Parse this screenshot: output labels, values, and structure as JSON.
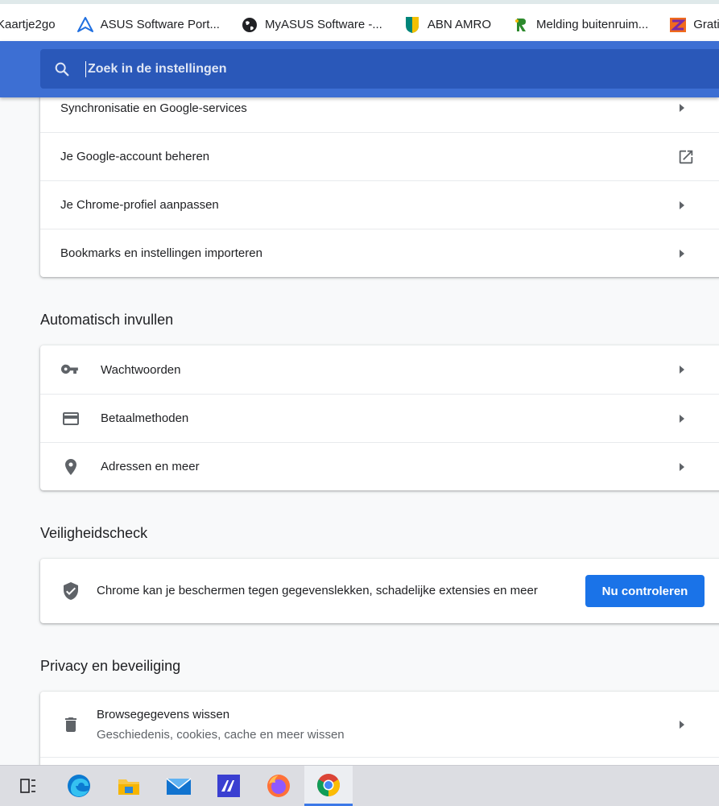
{
  "bookmarks": [
    {
      "label": "Kaartje2go",
      "icon": "none"
    },
    {
      "label": "ASUS Software Port...",
      "icon": "asus-logo-icon"
    },
    {
      "label": "MyASUS Software -...",
      "icon": "globe-icon"
    },
    {
      "label": "ABN AMRO",
      "icon": "abn-amro-shield-icon"
    },
    {
      "label": "Melding buitenruim...",
      "icon": "green-r-logo-icon"
    },
    {
      "label": "GratiZ.nl",
      "icon": "gratiz-logo-icon"
    }
  ],
  "search": {
    "placeholder": "Zoek in de instellingen"
  },
  "you_and_google": {
    "items": [
      {
        "label": "Synchronisatie en Google-services"
      },
      {
        "label": "Je Google-account beheren"
      },
      {
        "label": "Je Chrome-profiel aanpassen"
      },
      {
        "label": "Bookmarks en instellingen importeren"
      }
    ]
  },
  "autofill": {
    "title": "Automatisch invullen",
    "items": [
      {
        "label": "Wachtwoorden",
        "icon": "key-icon"
      },
      {
        "label": "Betaalmethoden",
        "icon": "credit-card-icon"
      },
      {
        "label": "Adressen en meer",
        "icon": "location-pin-icon"
      }
    ]
  },
  "safety": {
    "title": "Veiligheidscheck",
    "text": "Chrome kan je beschermen tegen gegevenslekken, schadelijke extensies en meer",
    "button": "Nu controleren"
  },
  "privacy": {
    "title": "Privacy en beveiliging",
    "items": [
      {
        "label": "Browsegegevens wissen",
        "sublabel": "Geschiedenis, cookies, cache en meer wissen",
        "icon": "trash-icon"
      }
    ]
  },
  "taskbar": {
    "items": [
      "task-view-icon",
      "edge-icon",
      "file-explorer-icon",
      "mail-icon",
      "app-icon",
      "firefox-icon",
      "chrome-icon"
    ],
    "active": "chrome-icon"
  },
  "colors": {
    "header": "#3d6fd3",
    "search_bg": "#2a58b9",
    "button": "#1a73e8",
    "icon_gray": "#5f6368"
  }
}
